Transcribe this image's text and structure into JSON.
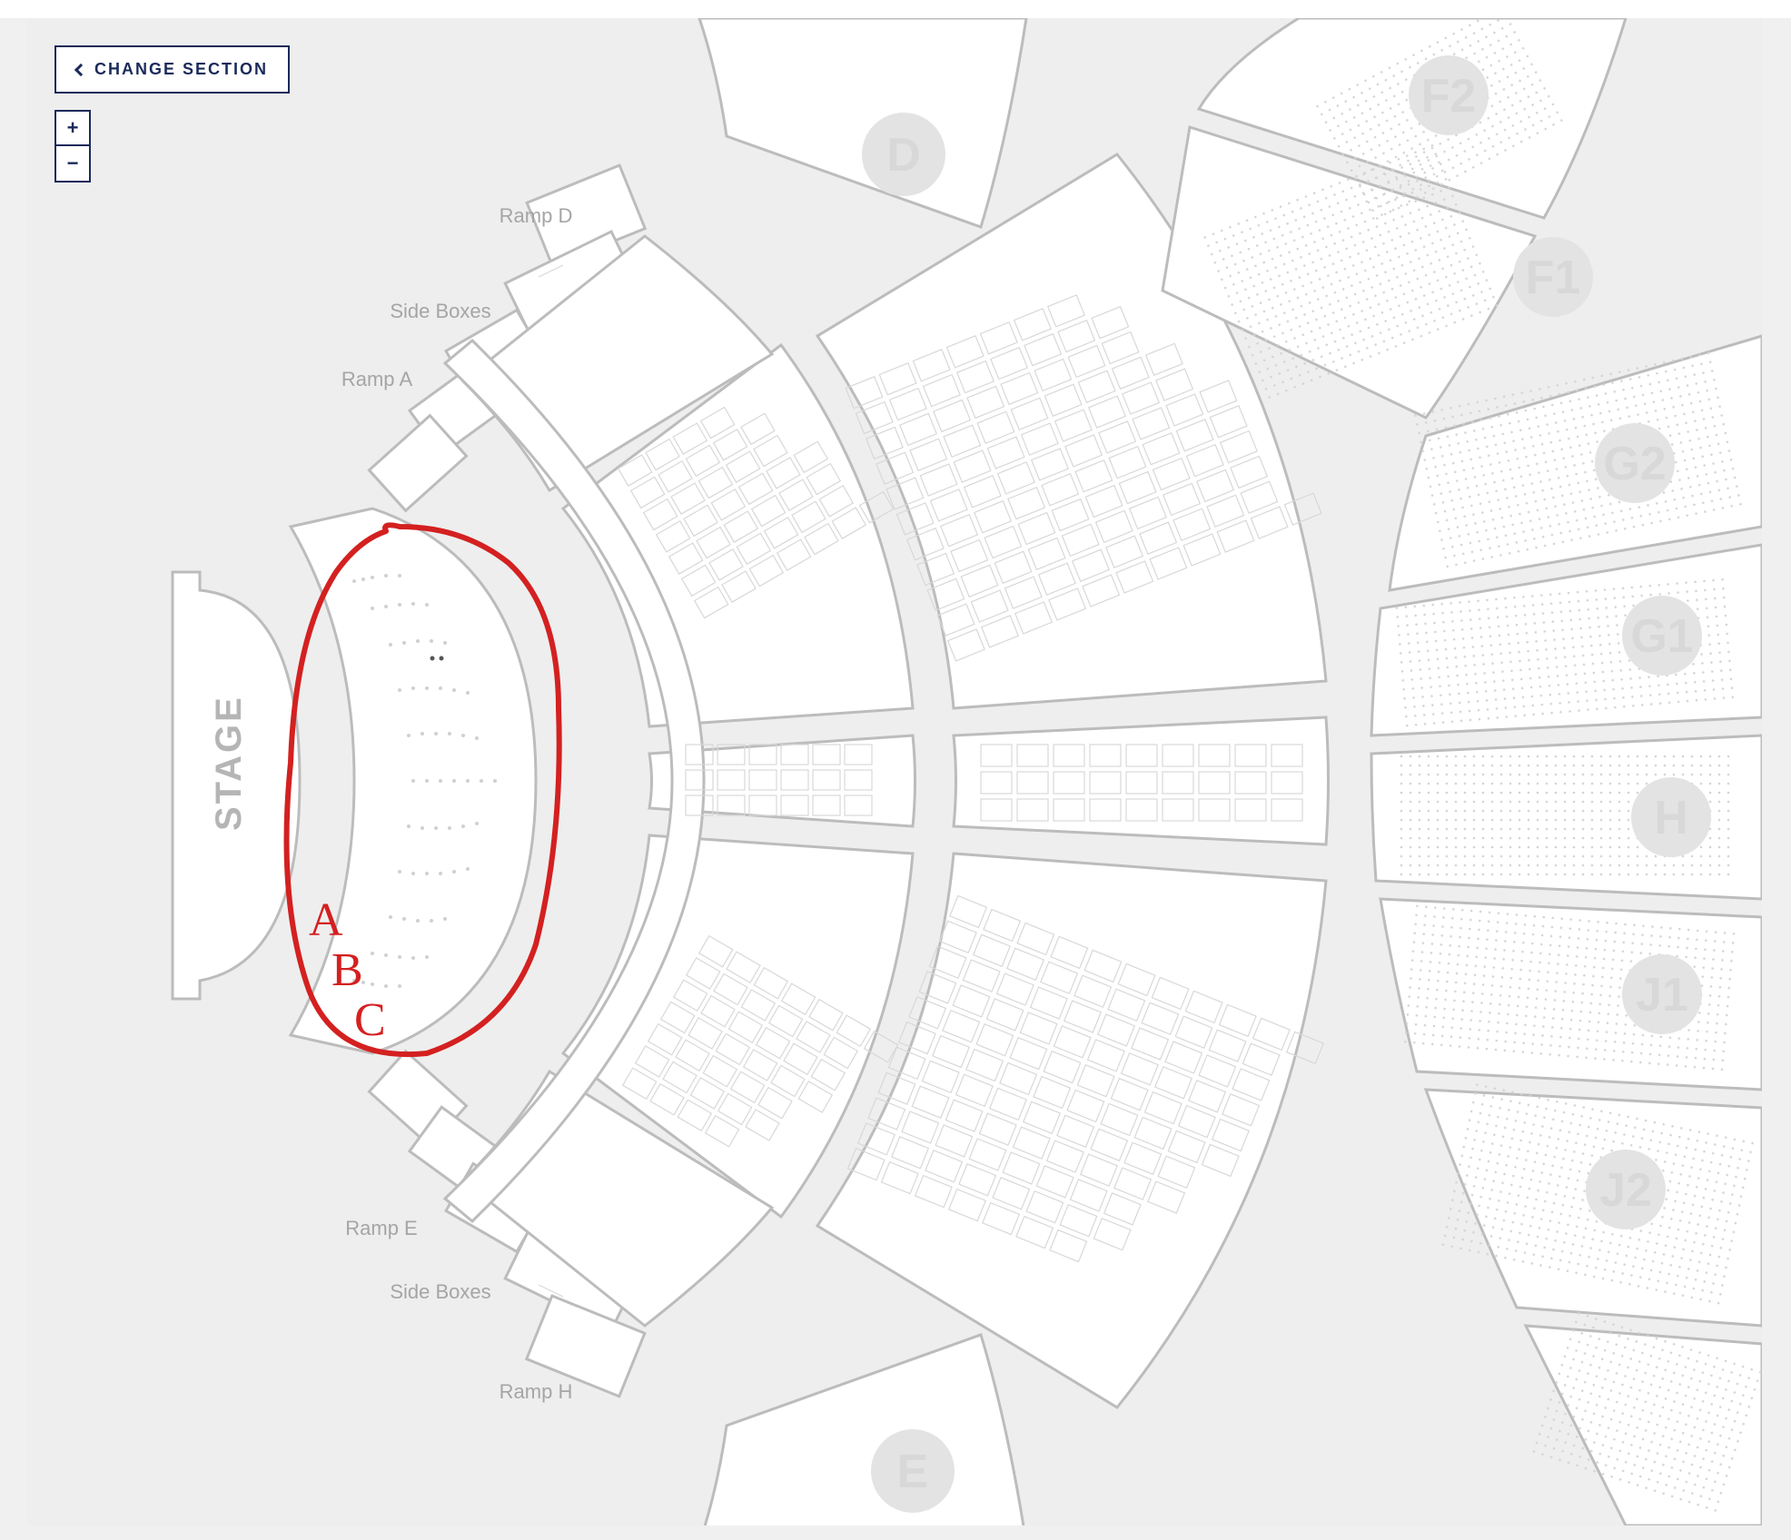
{
  "controls": {
    "change_section_label": "CHANGE SECTION",
    "zoom_in": "+",
    "zoom_out": "−"
  },
  "map": {
    "stage_label": "STAGE",
    "ramps": {
      "ramp_d": "Ramp D",
      "ramp_a": "Ramp A",
      "ramp_e": "Ramp E",
      "ramp_h": "Ramp H"
    },
    "side_boxes_top": "Side Boxes",
    "side_boxes_bottom": "Side Boxes",
    "sections": {
      "D": "D",
      "E": "E",
      "F1": "F1",
      "F2": "F2",
      "G1": "G1",
      "G2": "G2",
      "H": "H",
      "J1": "J1",
      "J2": "J2"
    }
  },
  "annotation": {
    "letters": [
      "A",
      "B",
      "C"
    ]
  }
}
